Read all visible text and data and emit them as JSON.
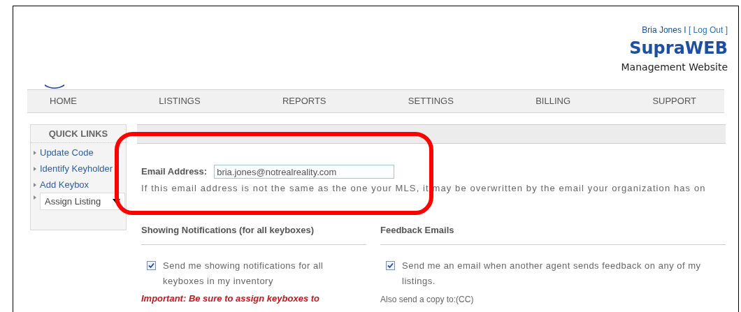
{
  "header": {
    "user": "Bria Jones",
    "separator": "I",
    "logout": "[ Log Out ]",
    "brand": "SupraWEB",
    "subtitle": "Management Website"
  },
  "nav": [
    {
      "label": "HOME"
    },
    {
      "label": "LISTINGS"
    },
    {
      "label": "REPORTS"
    },
    {
      "label": "SETTINGS"
    },
    {
      "label": "BILLING"
    },
    {
      "label": "SUPPORT"
    }
  ],
  "quick_links": {
    "title": "QUICK LINKS",
    "items": [
      {
        "kind": "link",
        "label": "Update Code"
      },
      {
        "kind": "link",
        "label": "Identify Keyholder"
      },
      {
        "kind": "link",
        "label": "Add Keybox"
      },
      {
        "kind": "select",
        "label": "Assign Listing"
      }
    ]
  },
  "email": {
    "label": "Email Address:",
    "value": "bria.jones@notrealreality.com",
    "note": "If this email address is not the same as the one your MLS, it may be overwritten by the email your organization has on"
  },
  "showing": {
    "title": "Showing Notifications (for all keyboxes)",
    "checked": true,
    "option": "Send me showing notifications for all keyboxes in my inventory",
    "warning": "Important: Be sure to assign keyboxes to"
  },
  "feedback": {
    "title": "Feedback Emails",
    "checked": true,
    "option": "Send me an email when another agent sends feedback on any of my listings.",
    "cc_label": "Also send a copy to:(CC)"
  }
}
